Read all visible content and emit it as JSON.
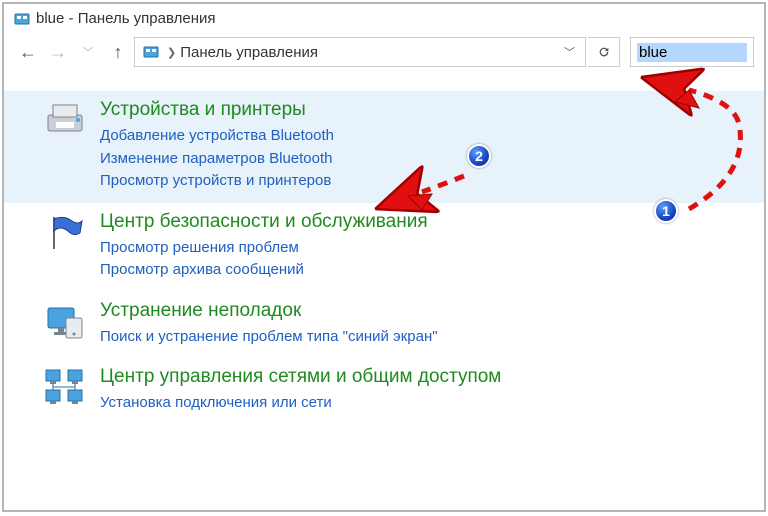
{
  "window": {
    "title": "blue - Панель управления"
  },
  "nav": {
    "breadcrumb": "Панель управления"
  },
  "search": {
    "value": "blue"
  },
  "results": [
    {
      "title": "Устройства и принтеры",
      "links": [
        "Добавление устройства Bluetooth",
        "Изменение параметров Bluetooth",
        "Просмотр устройств и принтеров"
      ]
    },
    {
      "title": "Центр безопасности и обслуживания",
      "links": [
        "Просмотр решения проблем",
        "Просмотр архива сообщений"
      ]
    },
    {
      "title": "Устранение неполадок",
      "links": [
        "Поиск и устранение проблем типа \"синий экран\""
      ]
    },
    {
      "title": "Центр управления сетями и общим доступом",
      "links": [
        "Установка подключения или сети"
      ]
    }
  ],
  "annotations": {
    "badge1": "1",
    "badge2": "2"
  }
}
